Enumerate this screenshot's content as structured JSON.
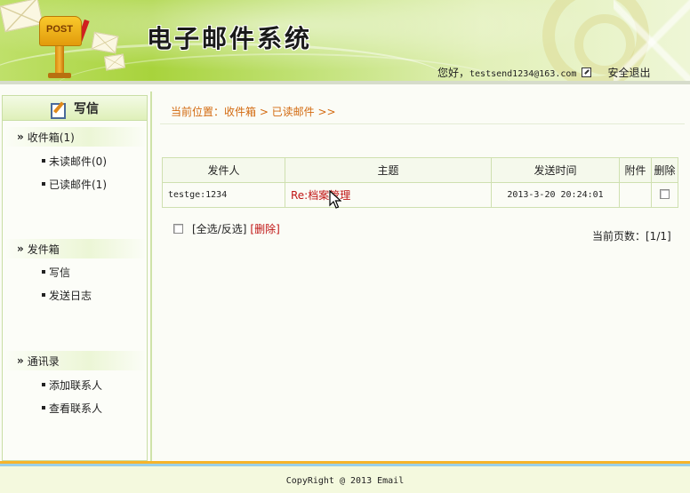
{
  "app": {
    "title": "电子邮件系统"
  },
  "logo": {
    "post_text": "POST"
  },
  "user": {
    "greeting": "您好，",
    "email": "testsend1234@163.com",
    "logout_label": "安全退出"
  },
  "sidebar": {
    "compose_label": "写信",
    "groups": [
      {
        "label": "收件箱(1)",
        "items": [
          {
            "label": "未读邮件(0)"
          },
          {
            "label": "已读邮件(1)"
          }
        ]
      },
      {
        "label": "发件箱",
        "items": [
          {
            "label": "写信"
          },
          {
            "label": "发送日志"
          }
        ]
      },
      {
        "label": "通讯录",
        "items": [
          {
            "label": "添加联系人"
          },
          {
            "label": "查看联系人"
          }
        ]
      }
    ]
  },
  "breadcrumb": "当前位置：收件箱 > 已读邮件 >>",
  "mail_table": {
    "headers": [
      "发件人",
      "主题",
      "发送时间",
      "附件",
      "删除"
    ],
    "rows": [
      {
        "sender": "testge:1234",
        "subject": "Re:档案管理",
        "time": "2013-3-20 20:24:01",
        "attachment": ""
      }
    ]
  },
  "actions": {
    "select_label": "[全选/反选]",
    "delete_label": "[删除]"
  },
  "pagination": {
    "label": "当前页数：[1/1]"
  },
  "footer": {
    "copyright": "CopyRight @ 2013 Email"
  },
  "colors": {
    "accent": "#a8d33c",
    "link_red": "#c01414",
    "breadcrumb": "#d36a10"
  }
}
